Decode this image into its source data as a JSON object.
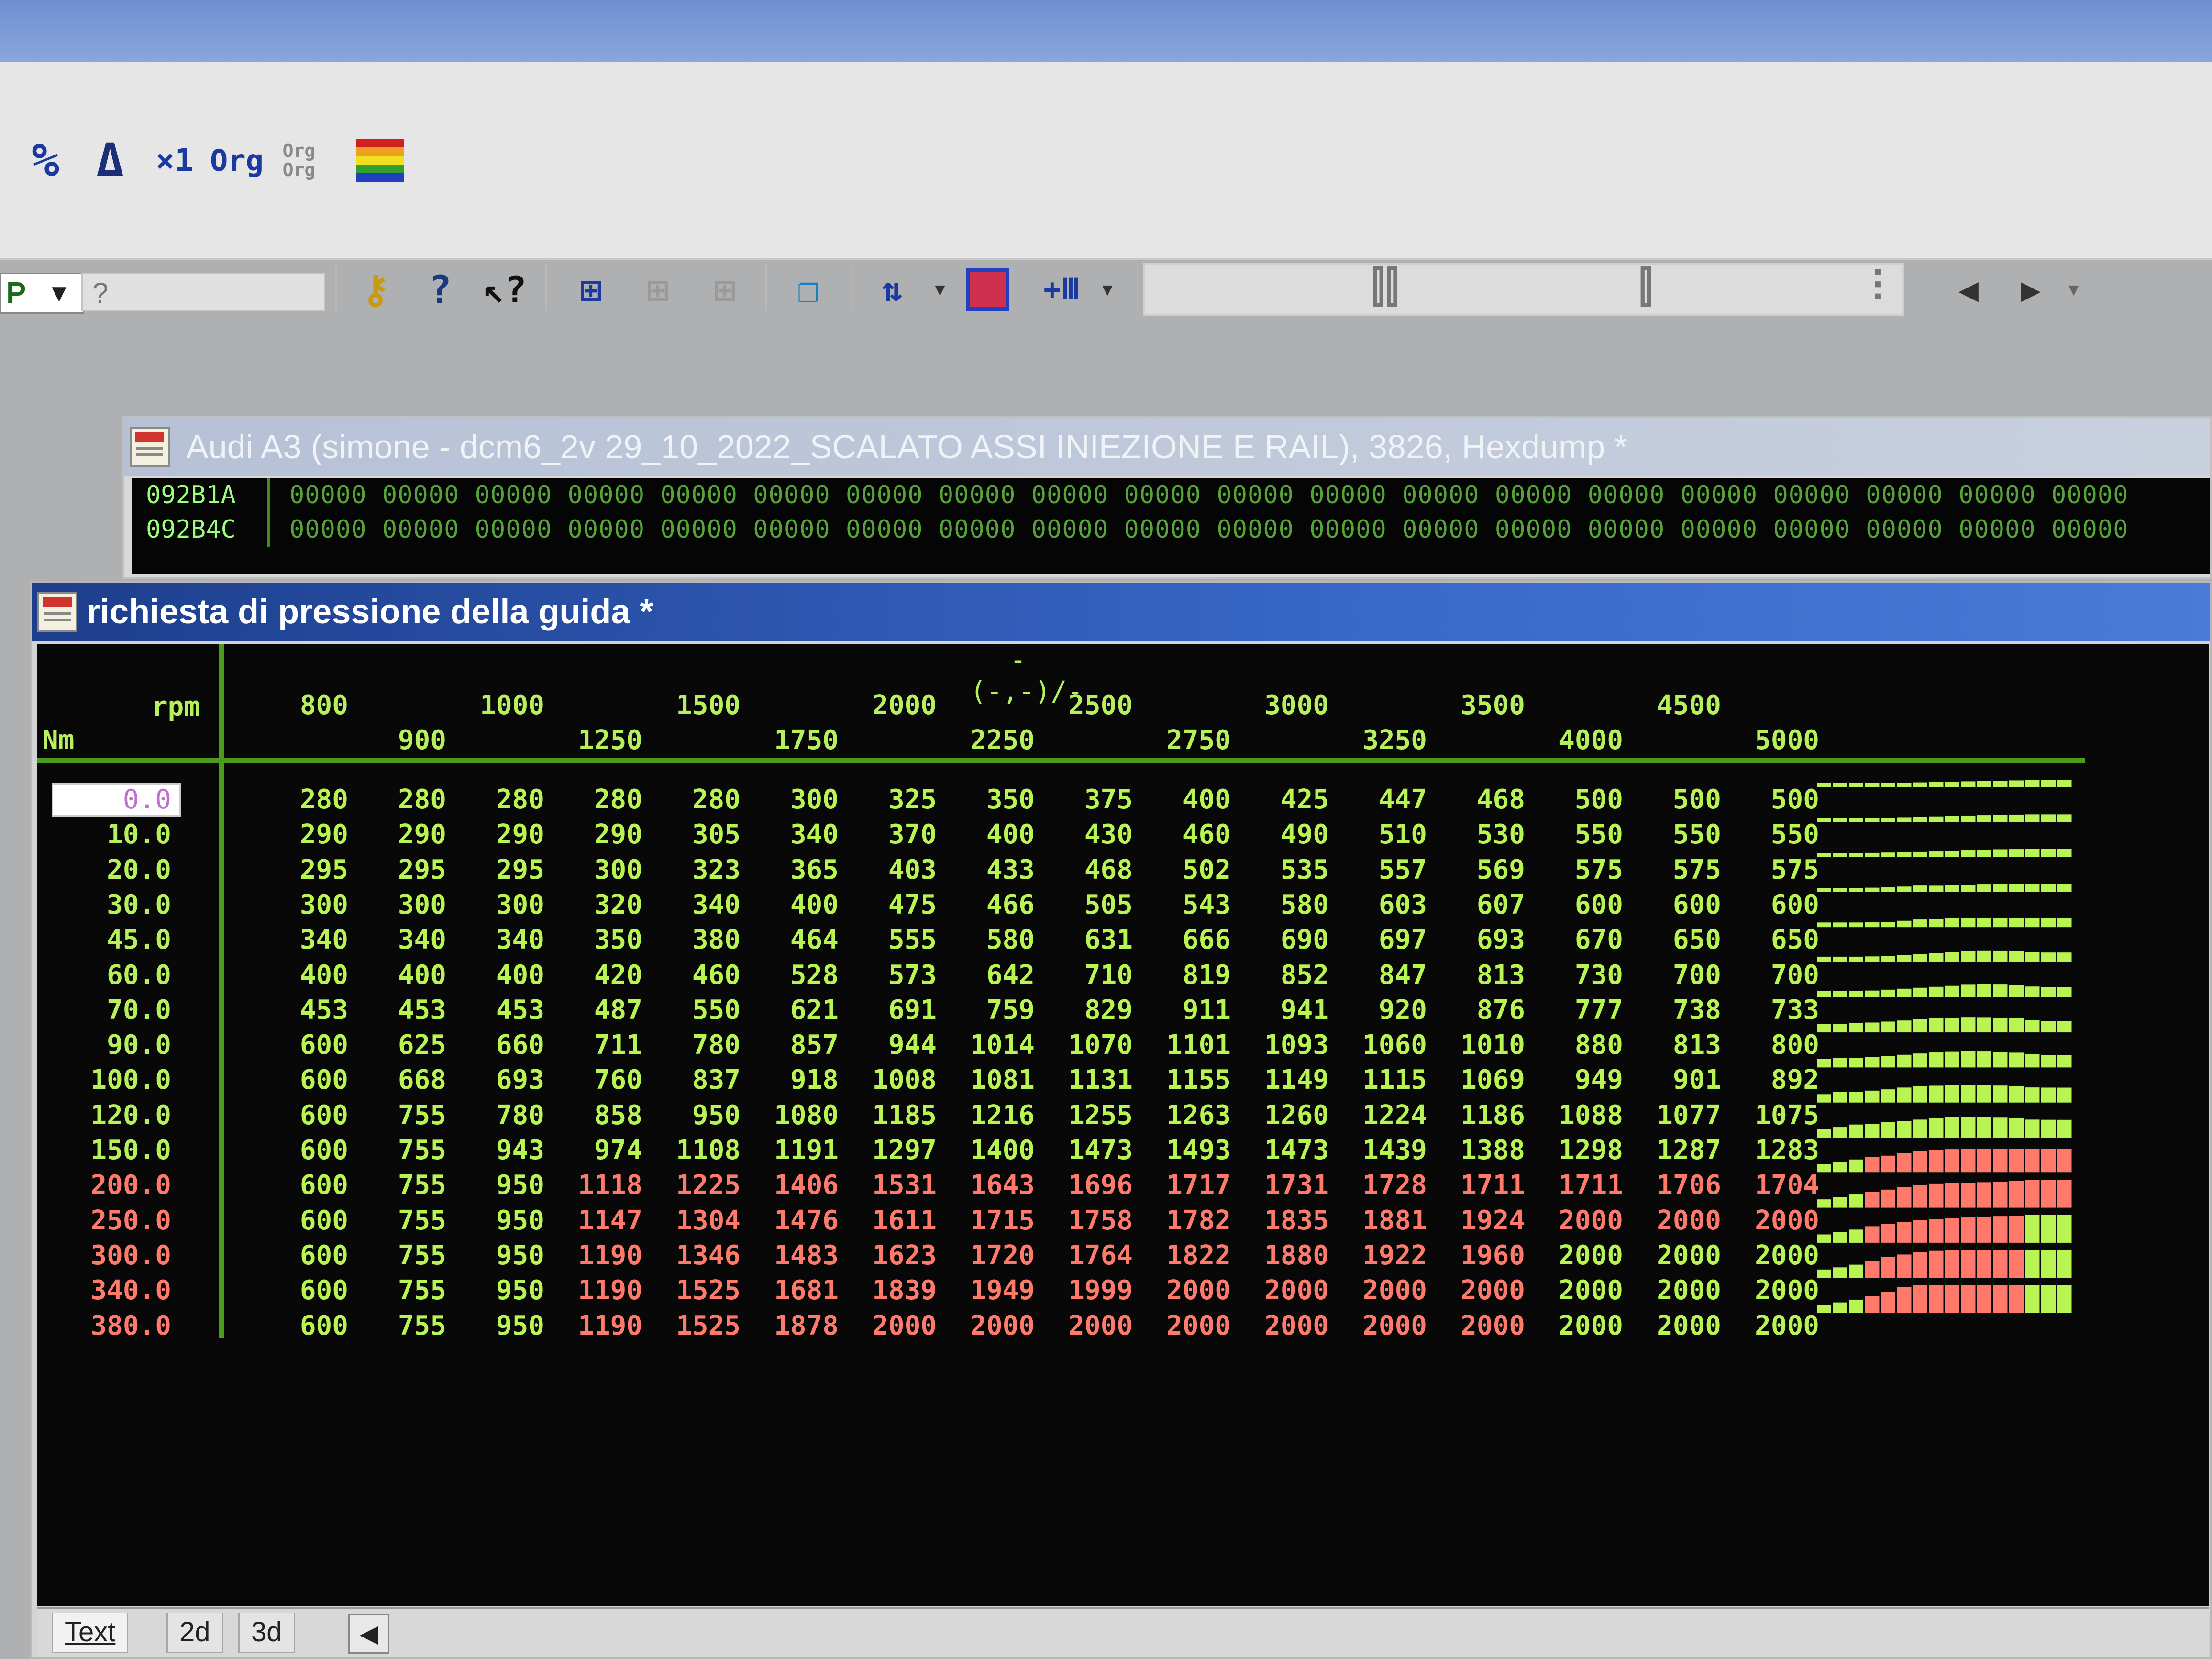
{
  "toolbar": {
    "row1": [
      {
        "name": "percent-icon",
        "glyph": "%"
      },
      {
        "name": "delta-icon",
        "glyph": "Δ"
      },
      {
        "name": "multiply-icon",
        "glyph": "×1"
      },
      {
        "name": "org-icon",
        "glyph": "Org"
      },
      {
        "name": "org-compare-icon",
        "glyph": "Org Org"
      },
      {
        "name": "color-palette-icon",
        "glyph": ""
      }
    ],
    "combo_value": "P",
    "combo_text": "?"
  },
  "hexdump_window": {
    "title": "Audi A3 (simone - dcm6_2v 29_10_2022_SCALATO ASSI INIEZIONE E RAIL), 3826, Hexdump *",
    "rows": [
      {
        "addr": "092B1A",
        "cells": "00000 00000 00000 00000 00000 00000 00000 00000 00000 00000 00000 00000 00000 00000 00000 00000 00000 00000 00000 00000"
      },
      {
        "addr": "092B4C",
        "cells": "00000 00000 00000 00000 00000 00000 00000 00000 00000 00000 00000 00000 00000 00000 00000 00000 00000 00000 00000 00000"
      }
    ]
  },
  "map_window": {
    "title": "richiesta di pressione della guida *",
    "factor_label": "-(-,-)/-",
    "x_axis_unit": "rpm",
    "y_axis_unit": "Nm",
    "x_axis": [
      "800",
      "900",
      "1000",
      "1250",
      "1500",
      "1750",
      "2000",
      "2250",
      "2500",
      "2750",
      "3000",
      "3250",
      "3500",
      "4000",
      "4500",
      "5000"
    ],
    "y_axis": [
      "0.0",
      "10.0",
      "20.0",
      "30.0",
      "45.0",
      "60.0",
      "70.0",
      "90.0",
      "100.0",
      "120.0",
      "150.0",
      "200.0",
      "250.0",
      "300.0",
      "340.0",
      "380.0"
    ],
    "colors": {
      "green": "#b9f552",
      "red": "#ff7a6a",
      "grid": "#4c9a1e"
    },
    "values": [
      [
        280,
        280,
        280,
        280,
        280,
        300,
        325,
        350,
        375,
        400,
        425,
        447,
        468,
        500,
        500,
        500
      ],
      [
        290,
        290,
        290,
        290,
        305,
        340,
        370,
        400,
        430,
        460,
        490,
        510,
        530,
        550,
        550,
        550
      ],
      [
        295,
        295,
        295,
        300,
        323,
        365,
        403,
        433,
        468,
        502,
        535,
        557,
        569,
        575,
        575,
        575
      ],
      [
        300,
        300,
        300,
        320,
        340,
        400,
        475,
        466,
        505,
        543,
        580,
        603,
        607,
        600,
        600,
        600
      ],
      [
        340,
        340,
        340,
        350,
        380,
        464,
        555,
        580,
        631,
        666,
        690,
        697,
        693,
        670,
        650,
        650
      ],
      [
        400,
        400,
        400,
        420,
        460,
        528,
        573,
        642,
        710,
        819,
        852,
        847,
        813,
        730,
        700,
        700
      ],
      [
        453,
        453,
        453,
        487,
        550,
        621,
        691,
        759,
        829,
        911,
        941,
        920,
        876,
        777,
        738,
        733
      ],
      [
        600,
        625,
        660,
        711,
        780,
        857,
        944,
        1014,
        1070,
        1101,
        1093,
        1060,
        1010,
        880,
        813,
        800
      ],
      [
        600,
        668,
        693,
        760,
        837,
        918,
        1008,
        1081,
        1131,
        1155,
        1149,
        1115,
        1069,
        949,
        901,
        892
      ],
      [
        600,
        755,
        780,
        858,
        950,
        1080,
        1185,
        1216,
        1255,
        1263,
        1260,
        1224,
        1186,
        1088,
        1077,
        1075
      ],
      [
        600,
        755,
        943,
        974,
        1108,
        1191,
        1297,
        1400,
        1473,
        1493,
        1473,
        1439,
        1388,
        1298,
        1287,
        1283
      ],
      [
        600,
        755,
        950,
        1118,
        1225,
        1406,
        1531,
        1643,
        1696,
        1717,
        1731,
        1728,
        1711,
        1711,
        1706,
        1704
      ],
      [
        600,
        755,
        950,
        1147,
        1304,
        1476,
        1611,
        1715,
        1758,
        1782,
        1835,
        1881,
        1924,
        2000,
        2000,
        2000
      ],
      [
        600,
        755,
        950,
        1190,
        1346,
        1483,
        1623,
        1720,
        1764,
        1822,
        1880,
        1922,
        1960,
        2000,
        2000,
        2000
      ],
      [
        600,
        755,
        950,
        1190,
        1525,
        1681,
        1839,
        1949,
        1999,
        2000,
        2000,
        2000,
        2000,
        2000,
        2000,
        2000
      ],
      [
        600,
        755,
        950,
        1190,
        1525,
        1878,
        2000,
        2000,
        2000,
        2000,
        2000,
        2000,
        2000,
        2000,
        2000,
        2000
      ]
    ],
    "red_mask": [
      [
        0,
        0,
        0,
        0,
        0,
        0,
        0,
        0,
        0,
        0,
        0,
        0,
        0,
        0,
        0,
        0
      ],
      [
        0,
        0,
        0,
        0,
        0,
        0,
        0,
        0,
        0,
        0,
        0,
        0,
        0,
        0,
        0,
        0
      ],
      [
        0,
        0,
        0,
        0,
        0,
        0,
        0,
        0,
        0,
        0,
        0,
        0,
        0,
        0,
        0,
        0
      ],
      [
        0,
        0,
        0,
        0,
        0,
        0,
        0,
        0,
        0,
        0,
        0,
        0,
        0,
        0,
        0,
        0
      ],
      [
        0,
        0,
        0,
        0,
        0,
        0,
        0,
        0,
        0,
        0,
        0,
        0,
        0,
        0,
        0,
        0
      ],
      [
        0,
        0,
        0,
        0,
        0,
        0,
        0,
        0,
        0,
        0,
        0,
        0,
        0,
        0,
        0,
        0
      ],
      [
        0,
        0,
        0,
        0,
        0,
        0,
        0,
        0,
        0,
        0,
        0,
        0,
        0,
        0,
        0,
        0
      ],
      [
        0,
        0,
        0,
        0,
        0,
        0,
        0,
        0,
        0,
        0,
        0,
        0,
        0,
        0,
        0,
        0
      ],
      [
        0,
        0,
        0,
        0,
        0,
        0,
        0,
        0,
        0,
        0,
        0,
        0,
        0,
        0,
        0,
        0
      ],
      [
        0,
        0,
        0,
        0,
        0,
        0,
        0,
        0,
        0,
        0,
        0,
        0,
        0,
        0,
        0,
        0
      ],
      [
        0,
        0,
        0,
        0,
        0,
        0,
        0,
        0,
        0,
        0,
        0,
        0,
        0,
        0,
        0,
        0
      ],
      [
        0,
        0,
        0,
        1,
        1,
        1,
        1,
        1,
        1,
        1,
        1,
        1,
        1,
        1,
        1,
        1
      ],
      [
        0,
        0,
        0,
        1,
        1,
        1,
        1,
        1,
        1,
        1,
        1,
        1,
        1,
        1,
        1,
        1
      ],
      [
        0,
        0,
        0,
        1,
        1,
        1,
        1,
        1,
        1,
        1,
        1,
        1,
        1,
        0,
        0,
        0
      ],
      [
        0,
        0,
        0,
        1,
        1,
        1,
        1,
        1,
        1,
        1,
        1,
        1,
        1,
        0,
        0,
        0
      ],
      [
        0,
        0,
        0,
        1,
        1,
        1,
        1,
        1,
        1,
        1,
        1,
        1,
        1,
        0,
        0,
        0
      ]
    ],
    "tabs": [
      "Text",
      "2d",
      "3d"
    ]
  }
}
